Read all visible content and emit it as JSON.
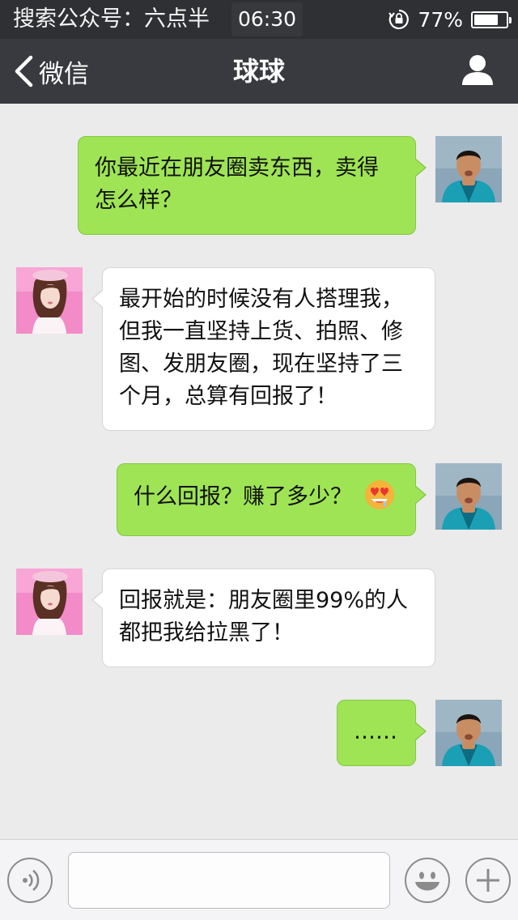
{
  "status_bar": {
    "carrier": "搜索公众号：六点半",
    "time": "06:30",
    "battery_percent_label": "77%",
    "battery_level": 0.77
  },
  "nav": {
    "back_label": "微信",
    "title": "球球",
    "back_icon": "chevron-left-icon",
    "profile_icon": "person-icon"
  },
  "messages": [
    {
      "sender": "me",
      "text": "你最近在朋友圈卖东西，卖得怎么样？"
    },
    {
      "sender": "other",
      "text": "最开始的时候没有人搭理我，但我一直坚持上货、拍照、修图、发朋友圈，现在坚持了三个月，总算有回报了！"
    },
    {
      "sender": "me",
      "text": "什么回报？赚了多少？",
      "emoji": "heart-eyes-drooling-emoji"
    },
    {
      "sender": "other",
      "text": "回报就是：朋友圈里99%的人都把我给拉黑了！"
    },
    {
      "sender": "me",
      "text": "……"
    }
  ],
  "input_bar": {
    "placeholder": "",
    "voice_icon": "voice-icon",
    "emoji_icon": "smiley-icon",
    "plus_icon": "plus-icon"
  },
  "colors": {
    "status_bar_bg": "#2e3033",
    "nav_bar_bg": "#393a3f",
    "chat_bg": "#ebebeb",
    "my_bubble": "#9ee455",
    "other_bubble": "#ffffff"
  }
}
